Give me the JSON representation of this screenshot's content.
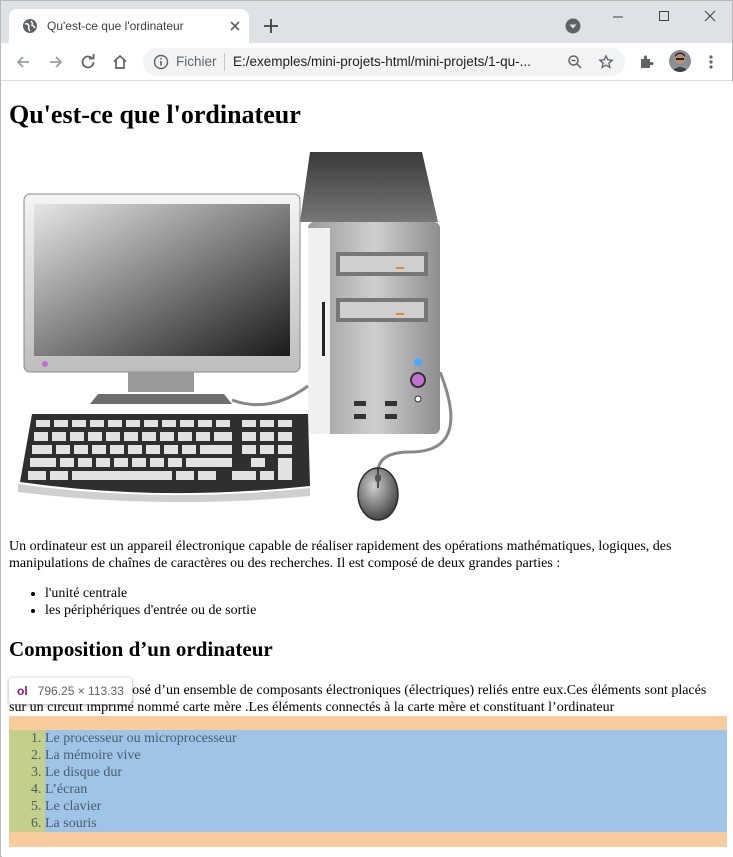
{
  "browser": {
    "tab_title": "Qu'est-ce que l'ordinateur",
    "scheme_label": "Fichier",
    "url": "E:/exemples/mini-projets-html/mini-projets/1-qu-...",
    "icons": [
      "globe-icon",
      "close-icon",
      "plus-icon",
      "profile-menu-icon",
      "minimize-icon",
      "maximize-icon",
      "close-window-icon",
      "back-icon",
      "forward-icon",
      "reload-icon",
      "home-icon",
      "info-icon",
      "zoom-icon",
      "star-icon",
      "extensions-icon",
      "avatar",
      "more-icon"
    ]
  },
  "page": {
    "title": "Qu'est-ce que l'ordinateur",
    "intro": "Un ordinateur est un appareil électronique capable de réaliser rapidement des opérations mathématiques, logiques, des manipulations de chaînes de caractères ou des recherches. Il est composé de deux grandes parties :",
    "parts": [
      "l'unité centrale",
      "les périphériques d'entrée ou de sortie"
    ],
    "section_title": "Composition d’un ordinateur",
    "section_text": "L’ordinateur est composé d’un ensemble de composants électroniques (électriques) reliés entre eux.Ces éléments sont placés sur un circuit imprimé nommé carte mère .Les éléments connectés à la carte mère et constituant l’ordinateur",
    "components": [
      "Le processeur ou microprocesseur",
      "La mémoire vive",
      "Le disque dur",
      "L’écran",
      "Le clavier",
      "La souris"
    ]
  },
  "devtools": {
    "tag": "ol",
    "dimensions": "796.25 × 113.33",
    "colors": {
      "margin": "#f9cc9d",
      "padding": "#c3d08b",
      "content": "#9fc4e7"
    }
  }
}
